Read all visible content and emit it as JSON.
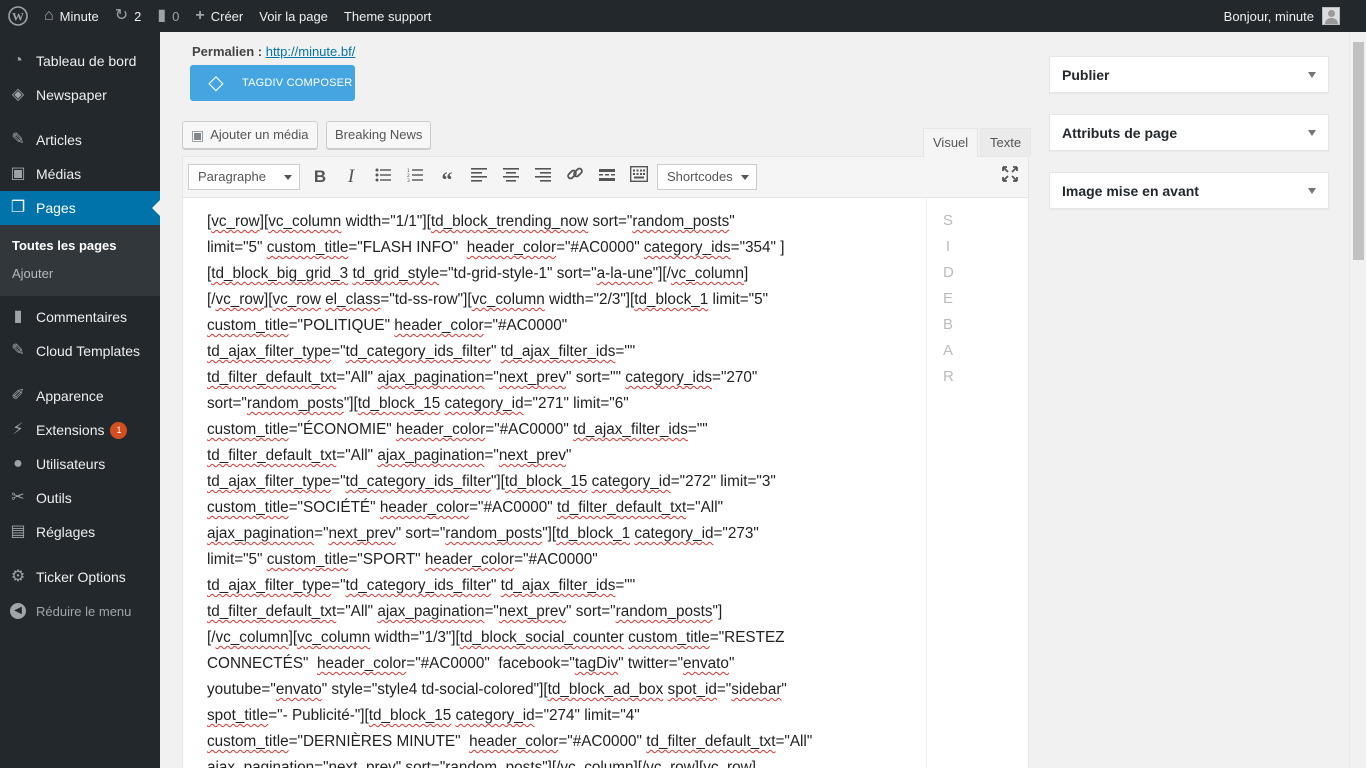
{
  "adminbar": {
    "site_name": "Minute",
    "updates_count": "2",
    "comments_count": "0",
    "new_label": "Créer",
    "view_page_label": "Voir la page",
    "theme_support_label": "Theme support",
    "greeting": "Bonjour, minute"
  },
  "sidebar": {
    "items": [
      {
        "label": "Tableau de bord",
        "icon": "dashboard-icon"
      },
      {
        "label": "Newspaper",
        "icon": "newspaper-icon"
      },
      {
        "label": "Articles",
        "icon": "pin-icon"
      },
      {
        "label": "Médias",
        "icon": "media-icon"
      },
      {
        "label": "Pages",
        "icon": "pages-icon"
      },
      {
        "label": "Commentaires",
        "icon": "comments-icon"
      },
      {
        "label": "Cloud Templates",
        "icon": "pin-icon"
      },
      {
        "label": "Apparence",
        "icon": "appearance-icon"
      },
      {
        "label": "Extensions",
        "icon": "plugins-icon",
        "badge": "1"
      },
      {
        "label": "Utilisateurs",
        "icon": "users-icon"
      },
      {
        "label": "Outils",
        "icon": "tools-icon"
      },
      {
        "label": "Réglages",
        "icon": "settings-icon"
      },
      {
        "label": "Ticker Options",
        "icon": "gear-icon"
      }
    ],
    "submenu": [
      "Toutes les pages",
      "Ajouter"
    ],
    "collapse_label": "Réduire le menu"
  },
  "permalink": {
    "label": "Permalien :",
    "url": "http://minute.bf/"
  },
  "tagdiv_button": "TAGDIV COMPOSER",
  "media_buttons": {
    "add_media": "Ajouter un média",
    "breaking_news": "Breaking News"
  },
  "editor": {
    "tabs": [
      "Visuel",
      "Texte"
    ],
    "format_select": "Paragraphe",
    "shortcodes_select": "Shortcodes",
    "content_lines": [
      "[vc_row][vc_column width=\"1/1\"][td_block_trending_now sort=\"random_posts\"",
      "limit=\"5\" custom_title=\"FLASH INFO\"  header_color=\"#AC0000\" category_ids=\"354\" ]",
      "[td_block_big_grid_3 td_grid_style=\"td-grid-style-1\" sort=\"a-la-une\"][/vc_column]",
      "[/vc_row][vc_row el_class=\"td-ss-row\"][vc_column width=\"2/3\"][td_block_1 limit=\"5\"",
      "custom_title=\"POLITIQUE\" header_color=\"#AC0000\"",
      "td_ajax_filter_type=\"td_category_ids_filter\" td_ajax_filter_ids=\"\"",
      "td_filter_default_txt=\"All\" ajax_pagination=\"next_prev\" sort=\"\" category_ids=\"270\"",
      "sort=\"random_posts\"][td_block_15 category_id=\"271\" limit=\"6\"",
      "custom_title=\"ÉCONOMIE\" header_color=\"#AC0000\" td_ajax_filter_ids=\"\"",
      "td_filter_default_txt=\"All\" ajax_pagination=\"next_prev\"",
      "td_ajax_filter_type=\"td_category_ids_filter\"][td_block_15 category_id=\"272\" limit=\"3\"",
      "custom_title=\"SOCIÉTÉ\" header_color=\"#AC0000\" td_filter_default_txt=\"All\"",
      "ajax_pagination=\"next_prev\" sort=\"random_posts\"][td_block_1 category_id=\"273\"",
      "limit=\"5\" custom_title=\"SPORT\" header_color=\"#AC0000\"",
      "td_ajax_filter_type=\"td_category_ids_filter\" td_ajax_filter_ids=\"\"",
      "td_filter_default_txt=\"All\" ajax_pagination=\"next_prev\" sort=\"random_posts\"]",
      "[/vc_column][vc_column width=\"1/3\"][td_block_social_counter custom_title=\"RESTEZ",
      "CONNECTÉS\"  header_color=\"#AC0000\"  facebook=\"tagDiv\" twitter=\"envato\"",
      "youtube=\"envato\" style=\"style4 td-social-colored\"][td_block_ad_box spot_id=\"sidebar\"",
      "spot_title=\"- Publicité-\"][td_block_15 category_id=\"274\" limit=\"4\"",
      "custom_title=\"DERNIÈRES MINUTE\"  header_color=\"#AC0000\" td_filter_default_txt=\"All\"",
      "ajax_pagination=\"next_prev\" sort=\"random_posts\"][/vc_column][/vc_row][vc_row]"
    ],
    "sidebar_letters": [
      "S",
      "I",
      "D",
      "E",
      "B",
      "A",
      "R"
    ]
  },
  "metaboxes": {
    "publish": "Publier",
    "page_attributes": "Attributs de page",
    "featured_image": "Image mise en avant"
  },
  "colors": {
    "adminbar_bg": "#23282d",
    "sidebar_current": "#0073aa",
    "tagdiv_button": "#45a5e1",
    "badge": "#d54e21"
  }
}
